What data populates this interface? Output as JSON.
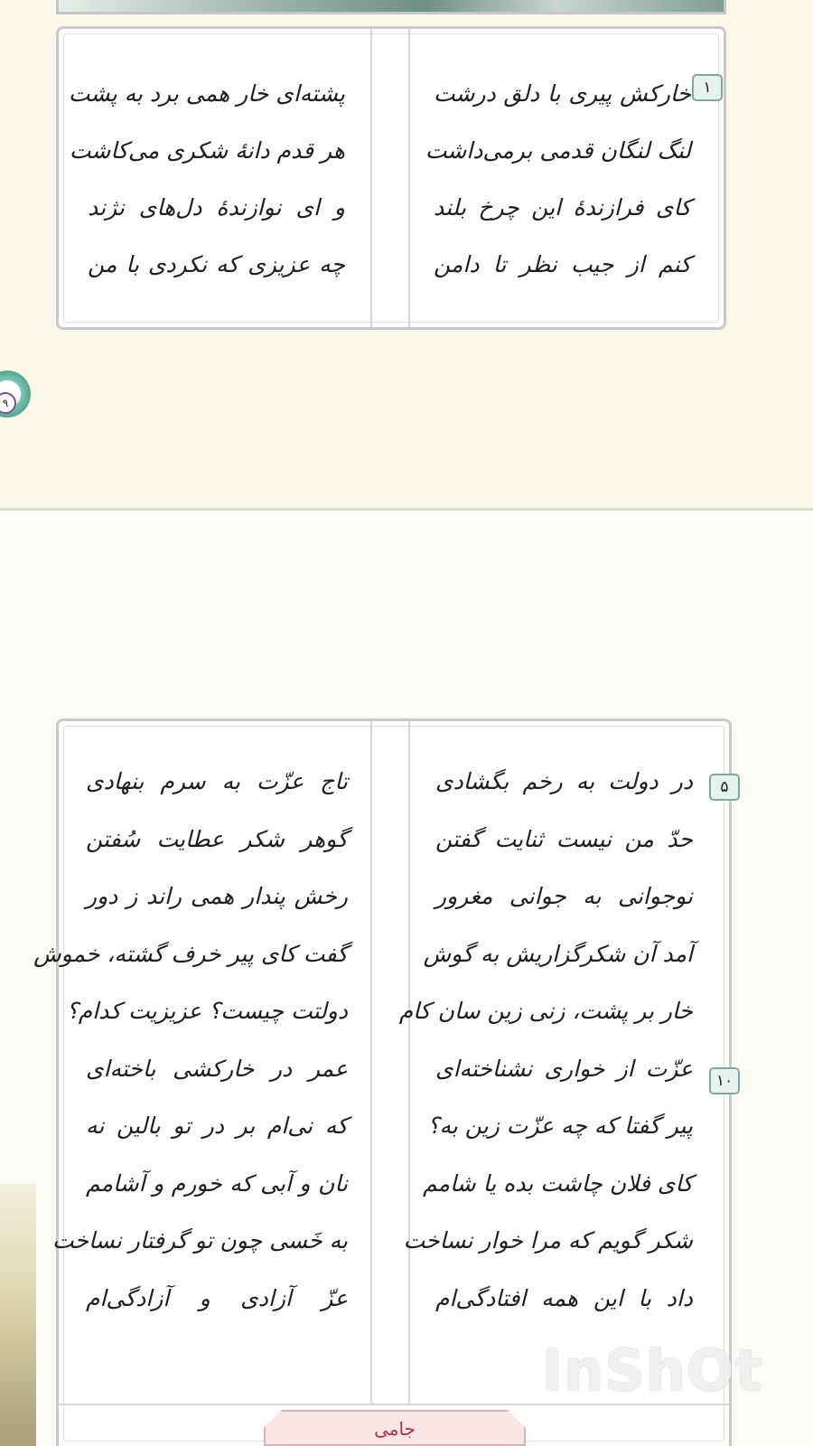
{
  "poem": {
    "stanza1": {
      "verse_number": "۱",
      "right_lines": [
        "خارکش پیری با دلق درشت",
        "لنگ لنگان قدمی برمی‌داشت",
        "کای فرازندهٔ این چرخ بلند",
        "کنم از جیب نظر تا دامن"
      ],
      "left_lines": [
        "پشته‌ای خار همی برد به پشت",
        "هر قدم دانهٔ شکری می‌کاشت",
        "و ای نوازندهٔ دل‌های نژند",
        "چه عزیزی که نکردی با من"
      ]
    },
    "stanza2": {
      "verse_numbers": [
        {
          "label": "۵",
          "line_index": 0
        },
        {
          "label": "۱۰",
          "line_index": 5
        }
      ],
      "right_lines": [
        "در دولت به رخم بگشادی",
        "حدّ من نیست ثنایت گفتن",
        "نوجوانی به جوانی مغرور",
        "آمد آن شکرگزاریش به گوش",
        "خار بر پشت، زنی زین سان کام",
        "عزّت از خواری نشناخته‌ای",
        "پیر گفتا که چه عزّت زین به؟",
        "کای فلان چاشت بده یا شامم",
        "شکر گویم که مرا خوار نساخت",
        "داد با این همه افتادگی‌ام"
      ],
      "left_lines": [
        "تاج عزّت به سرم بنهادی",
        "گوهر شکر عطایت سُفتن",
        "رخش پندار همی راند ز دور",
        "گفت کای پیر خرف گشته، خموش",
        "دولتت چیست؟ عزیزیت کدام؟",
        "عمر در خارکشی باخته‌ای",
        "که نی‌ام بر در تو بالین نه",
        "نان و آبی که خورم و آشامم",
        "به خَسی چون تو گرفتار نساخت",
        "عزّ آزادی و آزادگی‌ام"
      ]
    },
    "author": "جامی"
  },
  "page_number": "۹",
  "watermark": "InShOt"
}
